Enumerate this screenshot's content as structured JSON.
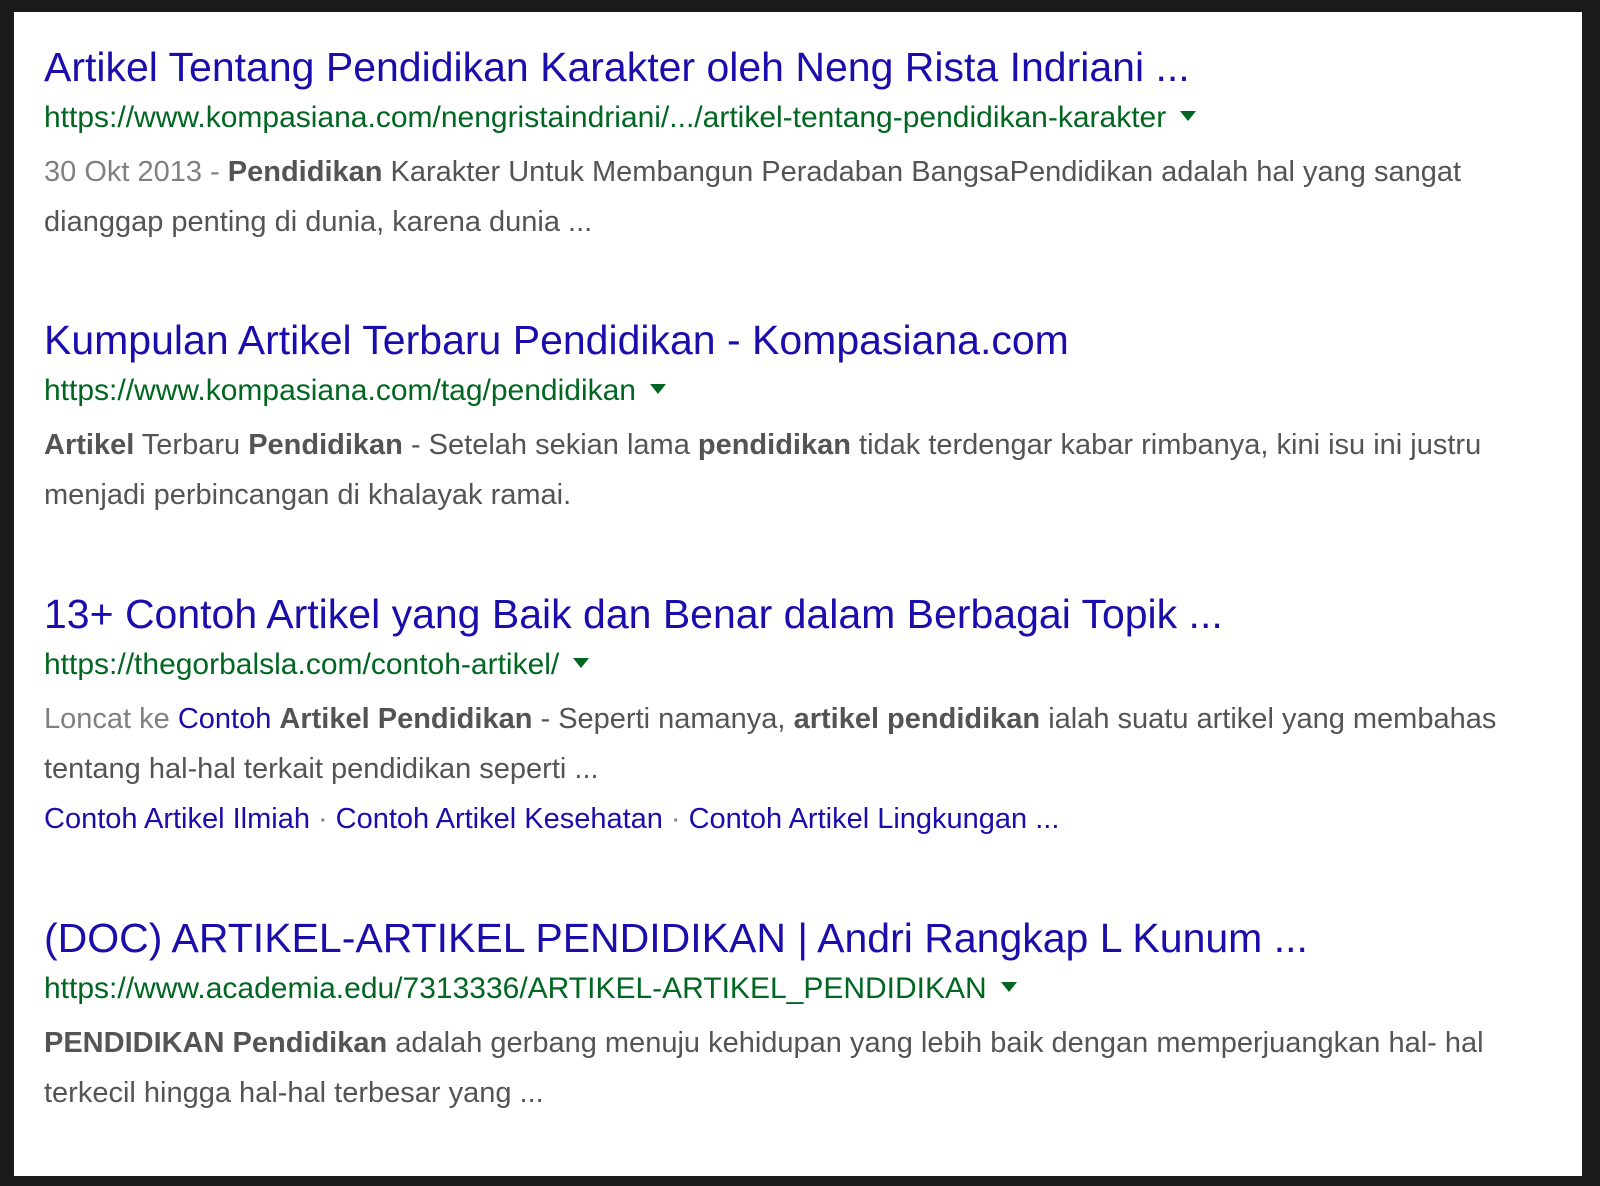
{
  "results": [
    {
      "title": "Artikel Tentang Pendidikan Karakter oleh Neng Rista Indriani ...",
      "url": "https://www.kompasiana.com/nengristaindriani/.../artikel-tentang-pendidikan-karakter",
      "date": "30 Okt 2013",
      "date_sep": " - ",
      "snippet_bold_1": "Pendidikan",
      "snippet_text_1": " Karakter Untuk Membangun Peradaban BangsaPendidikan adalah hal yang sangat dianggap penting di dunia, karena dunia ..."
    },
    {
      "title": "Kumpulan Artikel Terbaru Pendidikan - Kompasiana.com",
      "url": "https://www.kompasiana.com/tag/pendidikan",
      "snippet_bold_1": "Artikel",
      "snippet_text_1": " Terbaru ",
      "snippet_bold_2": "Pendidikan",
      "snippet_text_2": " - Setelah sekian lama ",
      "snippet_bold_3": "pendidikan",
      "snippet_text_3": " tidak terdengar kabar rimbanya, kini isu ini justru menjadi perbincangan di khalayak ramai."
    },
    {
      "title": "13+ Contoh Artikel yang Baik dan Benar dalam Berbagai Topik ...",
      "url": "https://thegorbalsla.com/contoh-artikel/",
      "jump_prefix": "Loncat ke ",
      "jump_link_text": "Contoh ",
      "jump_link_bold": "Artikel Pendidikan",
      "snippet_text_1": " - Seperti namanya, ",
      "snippet_bold_1": "artikel pendidikan",
      "snippet_text_2": " ialah suatu artikel yang membahas tentang hal-hal terkait pendidikan seperti ...",
      "sitelinks": [
        "Contoh Artikel Ilmiah",
        "Contoh Artikel Kesehatan",
        "Contoh Artikel Lingkungan ..."
      ],
      "sitelink_sep": "·"
    },
    {
      "title": "(DOC) ARTIKEL-ARTIKEL PENDIDIKAN | Andri Rangkap L Kunum ...",
      "url": "https://www.academia.edu/7313336/ARTIKEL-ARTIKEL_PENDIDIKAN",
      "snippet_bold_1": "PENDIDIKAN Pendidikan",
      "snippet_text_1": " adalah gerbang menuju kehidupan yang lebih baik dengan memperjuangkan hal- hal terkecil hingga hal-hal terbesar yang ..."
    }
  ],
  "colors": {
    "title": "#1a0dab",
    "url": "#006621",
    "snippet": "#545454",
    "date": "#808080",
    "frame": "#1a1a1a",
    "background": "#ffffff"
  },
  "icons": {
    "url_dropdown": "caret-down-icon"
  }
}
